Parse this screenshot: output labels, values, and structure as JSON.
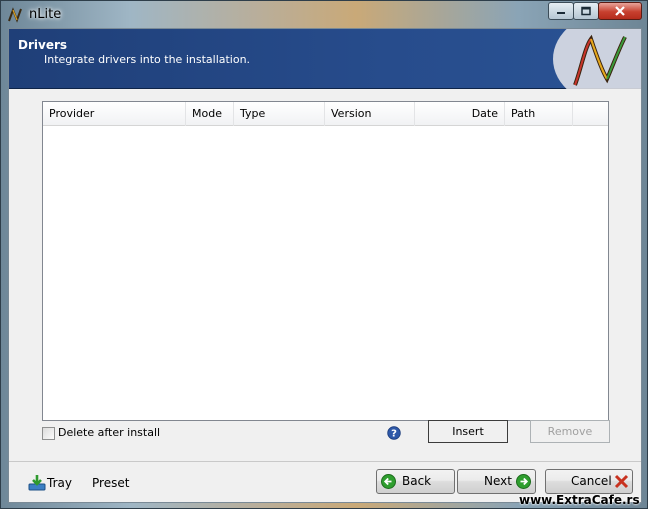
{
  "window": {
    "title": "nLite",
    "app_icon": "nlite-logo-icon",
    "controls": [
      "minimize-icon",
      "maximize-icon",
      "close-icon"
    ]
  },
  "header": {
    "title": "Drivers",
    "subtitle": "Integrate drivers into the installation.",
    "logo": "nlite-logo"
  },
  "driver_list": {
    "columns": [
      "Provider",
      "Mode",
      "Type",
      "Version",
      "Date",
      "Path"
    ],
    "rows": []
  },
  "options": {
    "delete_after_install": {
      "label": "Delete after install",
      "checked": false
    }
  },
  "actions": {
    "help_icon": "help-icon",
    "insert_label": "Insert",
    "remove_label": "Remove",
    "remove_enabled": false
  },
  "footer": {
    "tray_label": "Tray",
    "preset_label": "Preset",
    "back_label": "Back",
    "next_label": "Next",
    "cancel_label": "Cancel"
  },
  "watermark": "www.ExtraCafe.rs",
  "colors": {
    "header_bg": "#274c8c",
    "nav_icon_green": "#2f9e2f",
    "cancel_red": "#c8321f"
  }
}
